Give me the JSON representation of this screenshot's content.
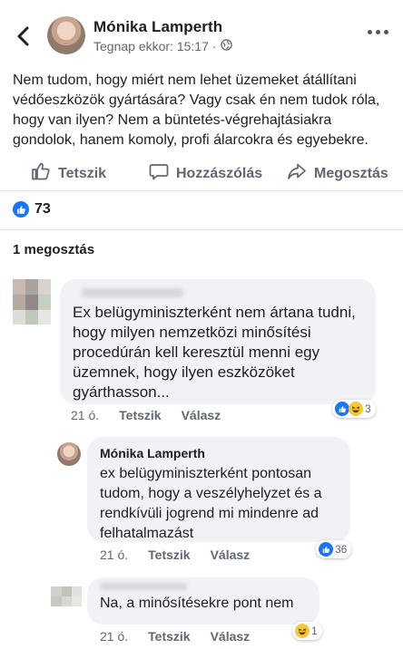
{
  "post": {
    "author": "Mónika Lamperth",
    "timestamp": "Tegnap ekkor: 15:17 ·",
    "visibility_icon": "globe-icon",
    "text": "Nem tudom, hogy miért nem lehet üzemeket átállítani védőeszközök gyártására? Vagy csak én nem tudok róla, hogy van ilyen? Nem a büntetés-végrehajtásiakra gondolok, hanem komoly, profi álarcokra és egyebekre."
  },
  "actions": {
    "like": "Tetszik",
    "comment": "Hozzászólás",
    "share": "Megosztás"
  },
  "reactions": {
    "count": "73"
  },
  "shares_label": "1 megosztás",
  "comments": [
    {
      "author": "",
      "text": "Ex  belügyminiszterként nem ártana tudni, hogy milyen nemzetközi minősítési procedúrán  kell keresztül menni egy üzemnek, hogy ilyen eszközöket gyárthasson...",
      "time": "21 ó.",
      "like": "Tetszik",
      "reply": "Válasz",
      "reaction_count": "3"
    },
    {
      "author": "Mónika Lamperth",
      "text": "ex belügyminiszterként pontosan tudom, hogy a veszélyhelyzet és a rendkívüli jogrend mi mindenre ad felhatalmazást",
      "time": "21 ó.",
      "like": "Tetszik",
      "reply": "Válasz",
      "reaction_count": "36"
    },
    {
      "author": "",
      "text": "Na, a minősítésekre pont nem",
      "time": "21 ó.",
      "like": "Tetszik",
      "reply": "Válasz",
      "reaction_count": "1"
    }
  ],
  "colors": {
    "brand_blue": "#1877f2",
    "bubble_gray": "#f0f2f5",
    "meta_gray": "#606770"
  }
}
